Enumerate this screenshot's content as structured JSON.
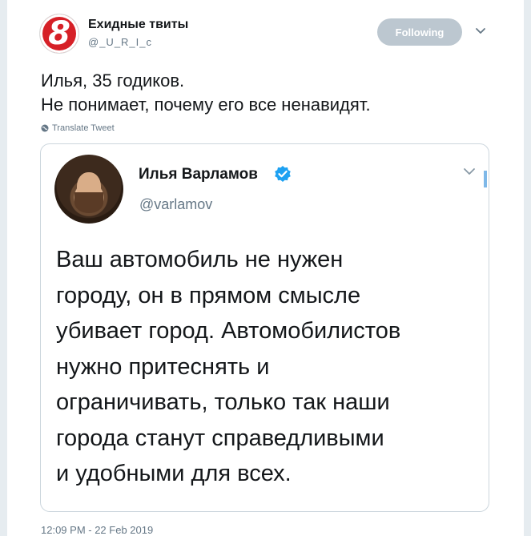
{
  "tweet": {
    "author_name": "Ехидные твиты",
    "author_handle": "@_U_R_I_c",
    "avatar_logo": "8",
    "follow_label": "Following",
    "text": "Илья, 35 годиков.\nНе понимает, почему его все ненавидят.",
    "translate_label": "Translate Tweet",
    "timestamp": "12:09 PM - 22 Feb 2019"
  },
  "quoted": {
    "author_name": "Илья Варламов",
    "author_handle": "@varlamov",
    "verified_icon": "verified-badge-icon",
    "text": "Ваш автомобиль не нужен\nгороду, он в прямом смысле\nубивает город. Автомобилистов\nнужно притеснять и\nограничивать, только так наши\nгорода станут справедливыми\nи удобными для всех."
  },
  "colors": {
    "logo_red": "#d62027",
    "follow_bg": "#bcc7d0",
    "verified_blue": "#1da1f2",
    "muted_text": "#657786",
    "border": "#ccd6dd"
  }
}
